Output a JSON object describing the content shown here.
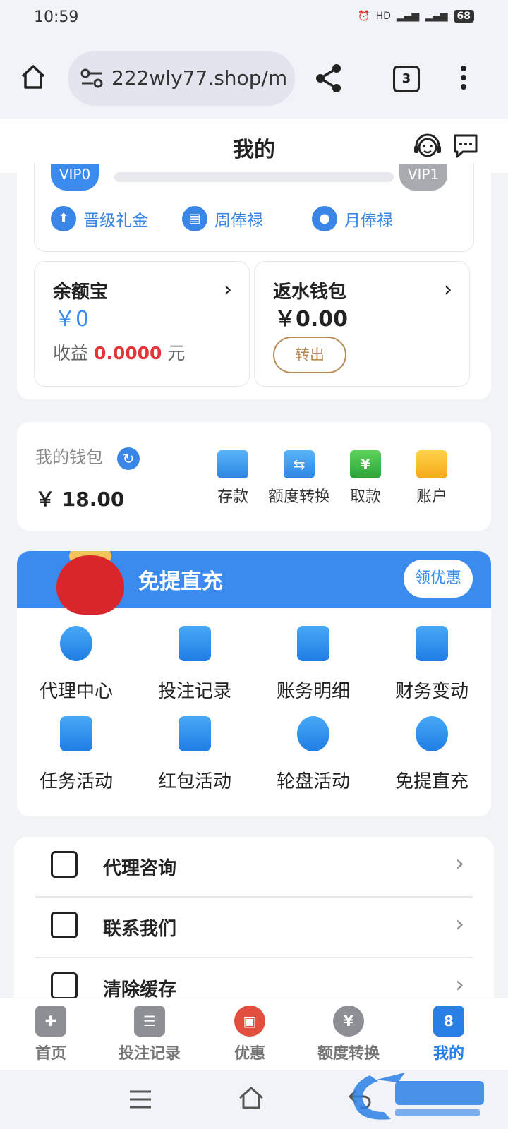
{
  "status": {
    "time": "10:59",
    "battery": "68"
  },
  "browser": {
    "url": "222wly77.shop/m",
    "tab_count": "3"
  },
  "header": {
    "title": "我的"
  },
  "vip": {
    "current_level": "VIP0",
    "next_level": "VIP1",
    "progress": 0,
    "perks": [
      "晋级礼金",
      "周俸禄",
      "月俸禄"
    ]
  },
  "balance_card": {
    "title": "余额宝",
    "amount": "￥0",
    "earnings_label": "收益",
    "earnings_value": "0.0000",
    "earnings_unit": "元"
  },
  "rebate_card": {
    "title": "返水钱包",
    "amount": "￥0.00",
    "transfer_out": "转出"
  },
  "wallet": {
    "label": "我的钱包",
    "amount": "￥ 18.00",
    "actions": [
      "存款",
      "额度转换",
      "取款",
      "账户"
    ]
  },
  "promo": {
    "title": "免提直充",
    "coupon_button": "领优惠"
  },
  "grid": [
    {
      "label": "代理中心",
      "icon": "agent-icon"
    },
    {
      "label": "投注记录",
      "icon": "bet-record-icon"
    },
    {
      "label": "账务明细",
      "icon": "account-detail-icon"
    },
    {
      "label": "财务变动",
      "icon": "finance-change-icon"
    },
    {
      "label": "任务活动",
      "icon": "task-icon"
    },
    {
      "label": "红包活动",
      "icon": "red-envelope-icon"
    },
    {
      "label": "轮盘活动",
      "icon": "wheel-icon"
    },
    {
      "label": "免提直充",
      "icon": "direct-charge-icon"
    }
  ],
  "menu": [
    "代理咨询",
    "联系我们",
    "清除缓存"
  ],
  "bottom_nav": [
    "首页",
    "投注记录",
    "优惠",
    "额度转换",
    "我的"
  ],
  "bottom_nav_badge": "8",
  "colors": {
    "accent": "#3b8bef",
    "red": "#e2373a",
    "gold": "#b98b56"
  }
}
